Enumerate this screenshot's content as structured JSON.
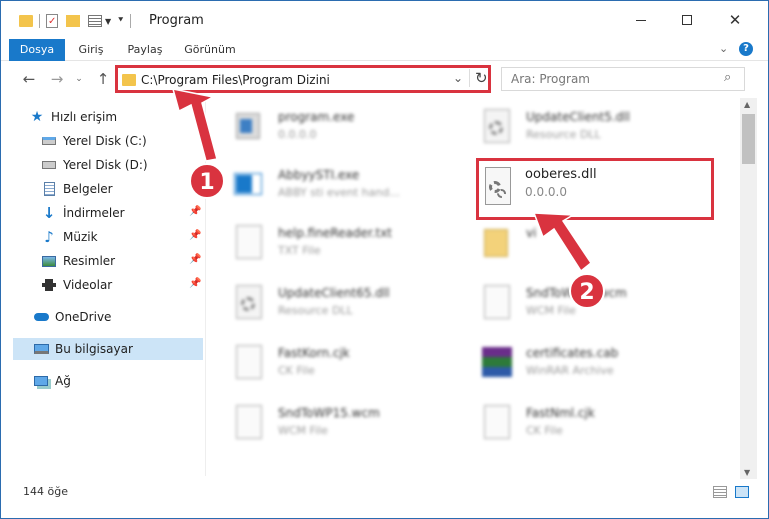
{
  "window": {
    "title": "Program"
  },
  "ribbon": {
    "tabs": [
      "Dosya",
      "Giriş",
      "Paylaş",
      "Görünüm"
    ]
  },
  "address": {
    "path": "C:\\Program Files\\Program Dizini"
  },
  "search": {
    "placeholder": "Ara: Program"
  },
  "sidebar": {
    "items": [
      {
        "label": "Hızlı erişim",
        "icon": "star-icon"
      },
      {
        "label": "Yerel Disk (C:)",
        "icon": "drive-icon"
      },
      {
        "label": "Yerel Disk (D:)",
        "icon": "drive-icon"
      },
      {
        "label": "Belgeler",
        "icon": "documents-icon"
      },
      {
        "label": "İndirmeler",
        "icon": "download-icon"
      },
      {
        "label": "Müzik",
        "icon": "music-icon"
      },
      {
        "label": "Resimler",
        "icon": "pictures-icon"
      },
      {
        "label": "Videolar",
        "icon": "video-icon"
      },
      {
        "label": "OneDrive",
        "icon": "cloud-icon"
      },
      {
        "label": "Bu bilgisayar",
        "icon": "computer-icon"
      },
      {
        "label": "Ağ",
        "icon": "network-icon"
      }
    ]
  },
  "files": [
    {
      "name": "program.exe",
      "type": "0.0.0.0"
    },
    {
      "name": "UpdateClient5.dll",
      "type": "Resource DLL"
    },
    {
      "name": "AbbyySTI.exe",
      "type": "ABBY sti event hand..."
    },
    {
      "name": "ooberes.dll",
      "type": "0.0.0.0"
    },
    {
      "name": "help.fineReader.txt",
      "type": "TXT File"
    },
    {
      "name": "vi",
      "type": ""
    },
    {
      "name": "UpdateClient65.dll",
      "type": "Resource DLL"
    },
    {
      "name": "SndToWPxx.wcm",
      "type": "WCM File"
    },
    {
      "name": "FastKorn.cjk",
      "type": "CK File"
    },
    {
      "name": "certificates.cab",
      "type": "WinRAR Archive"
    },
    {
      "name": "SndToWP15.wcm",
      "type": "WCM File"
    },
    {
      "name": "FastNml.cjk",
      "type": "CK File"
    }
  ],
  "status": {
    "count": "144 öğe"
  },
  "annotations": {
    "badge1": "1",
    "badge2": "2"
  }
}
